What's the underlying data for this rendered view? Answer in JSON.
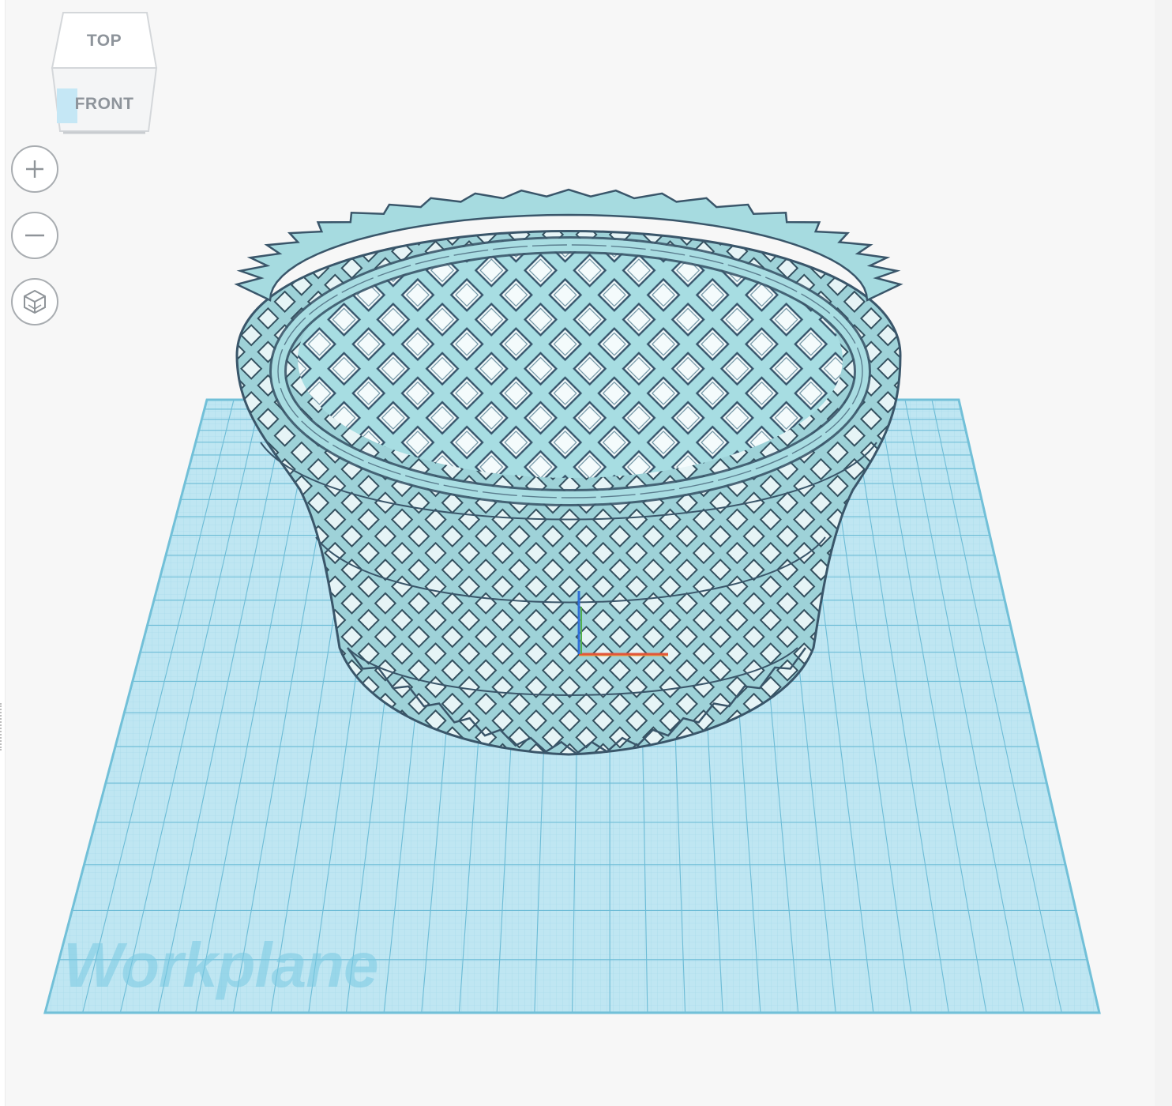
{
  "view_cube": {
    "top_label": "TOP",
    "front_label": "FRONT"
  },
  "controls": {
    "zoom_in": {
      "icon": "plus-icon"
    },
    "zoom_out": {
      "icon": "minus-icon"
    },
    "home_view": {
      "icon": "cube-home-icon"
    }
  },
  "workplane": {
    "label": "Workplane"
  },
  "colors": {
    "grid_fill": "#bfe6f2",
    "grid_line": "#7cc7dd",
    "model_fill": "#a6dbe0",
    "model_edge": "#3d5a6c",
    "axis_x": "#e2563a",
    "axis_y": "#52b04a",
    "axis_z": "#2f6fd8"
  }
}
